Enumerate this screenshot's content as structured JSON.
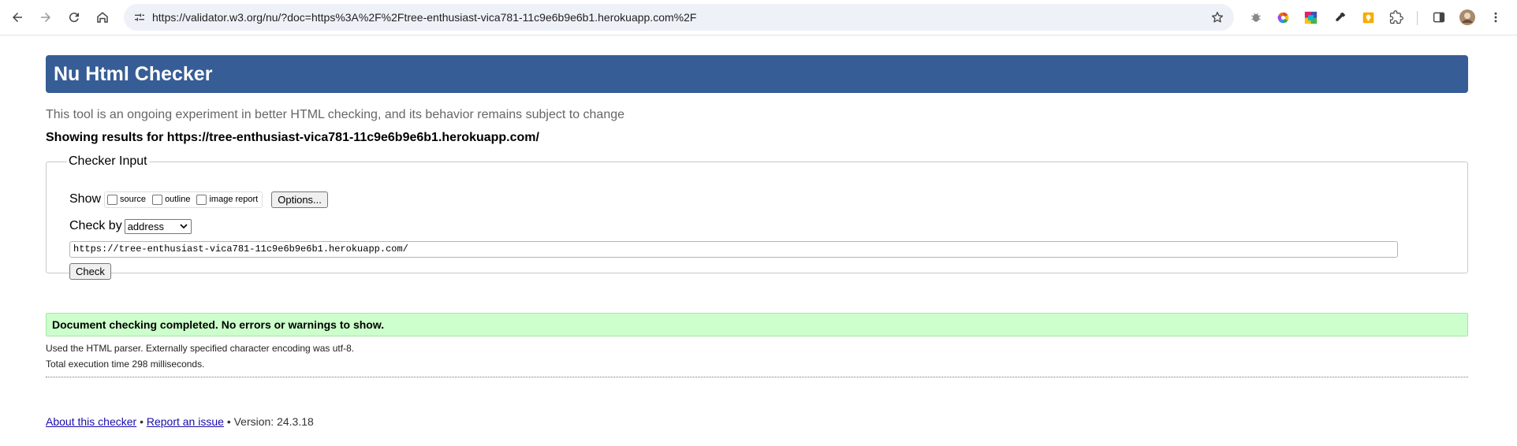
{
  "browser": {
    "url": "https://validator.w3.org/nu/?doc=https%3A%2F%2Ftree-enthusiast-vica781-11c9e6b9e6b1.herokuapp.com%2F",
    "icons": [
      "back-icon",
      "forward-icon",
      "reload-icon",
      "home-icon",
      "site-settings-icon",
      "bookmark-star-icon",
      "extension-bug-icon",
      "extension-color-wheel-icon",
      "extension-palette-icon",
      "extension-eyedropper-icon",
      "extension-keep-icon",
      "extensions-puzzle-icon",
      "side-panel-icon",
      "profile-avatar",
      "menu-kebab-icon"
    ]
  },
  "header": {
    "title": "Nu Html Checker",
    "subtitle": "This tool is an ongoing experiment in better HTML checking, and its behavior remains subject to change",
    "results_for": "Showing results for https://tree-enthusiast-vica781-11c9e6b9e6b1.herokuapp.com/"
  },
  "checker_input": {
    "legend": "Checker Input",
    "show_label": "Show",
    "options": [
      "source",
      "outline",
      "image report"
    ],
    "options_button": "Options...",
    "check_by_label": "Check by",
    "check_by_value": "address",
    "address_value": "https://tree-enthusiast-vica781-11c9e6b9e6b1.herokuapp.com/",
    "check_button": "Check"
  },
  "results": {
    "success_message": "Document checking completed. No errors or warnings to show.",
    "parser_info": "Used the HTML parser. Externally specified character encoding was utf-8.",
    "execution_time": "Total execution time 298 milliseconds."
  },
  "footer": {
    "about_link": "About this checker",
    "bullet": "•",
    "report_link": "Report an issue",
    "version": "Version: 24.3.18"
  },
  "colors": {
    "banner": "#365d95",
    "success_bg": "#ccffcc",
    "link": "#1a0dab"
  }
}
